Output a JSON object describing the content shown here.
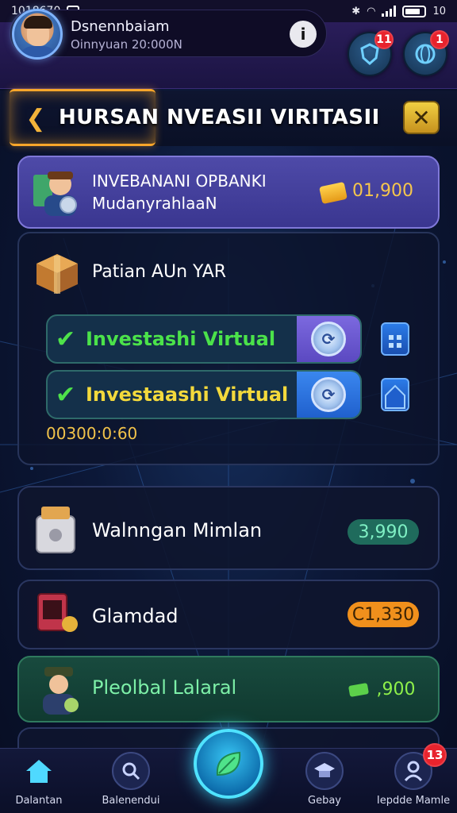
{
  "status_bar": {
    "time": "1018670",
    "right_text": "10"
  },
  "profile": {
    "name": "Dsnennbaiam",
    "subtitle": "Oinnyuan 20:000N"
  },
  "header_buttons": [
    {
      "icon": "shield-icon",
      "badge": "11"
    },
    {
      "icon": "globe-icon",
      "badge": "1"
    }
  ],
  "title": "HURSAN NVEASII VIRITASII",
  "top_card": {
    "line1": "INVEBANANI OPBANKI",
    "line2": "MudanyrahlaaN",
    "amount": "01,900"
  },
  "main_card": {
    "title": "Patian AUn YAR",
    "rows": [
      {
        "label": "Investashi Virtual",
        "color": "#4be24a"
      },
      {
        "label": "Investaashi Virtual",
        "color": "#f3d93c"
      }
    ],
    "timer": "00300:0:60"
  },
  "list_items": [
    {
      "name": "Walnngan Mimlan",
      "value": "3,990",
      "value_color": "#7ff0c4",
      "pill_bg": "#1f6b5c"
    },
    {
      "name": "Glamdad",
      "value": "C1,330",
      "value_color": "#3a2305",
      "pill_bg": "#f0901c"
    },
    {
      "name": "Pleolbal Lalaral",
      "value": ",900",
      "value_color": "#8ef04a",
      "pill_bg": ""
    }
  ],
  "nav": {
    "items": [
      {
        "label": "Dalantan",
        "icon": "home-icon"
      },
      {
        "label": "Balenendui",
        "icon": "search-icon"
      },
      {
        "label": "Gebay",
        "icon": "hat-icon"
      },
      {
        "label": "Iepdde Mamle",
        "icon": "profile-icon"
      }
    ],
    "center_icon": "leaf-icon",
    "badge": "13"
  }
}
